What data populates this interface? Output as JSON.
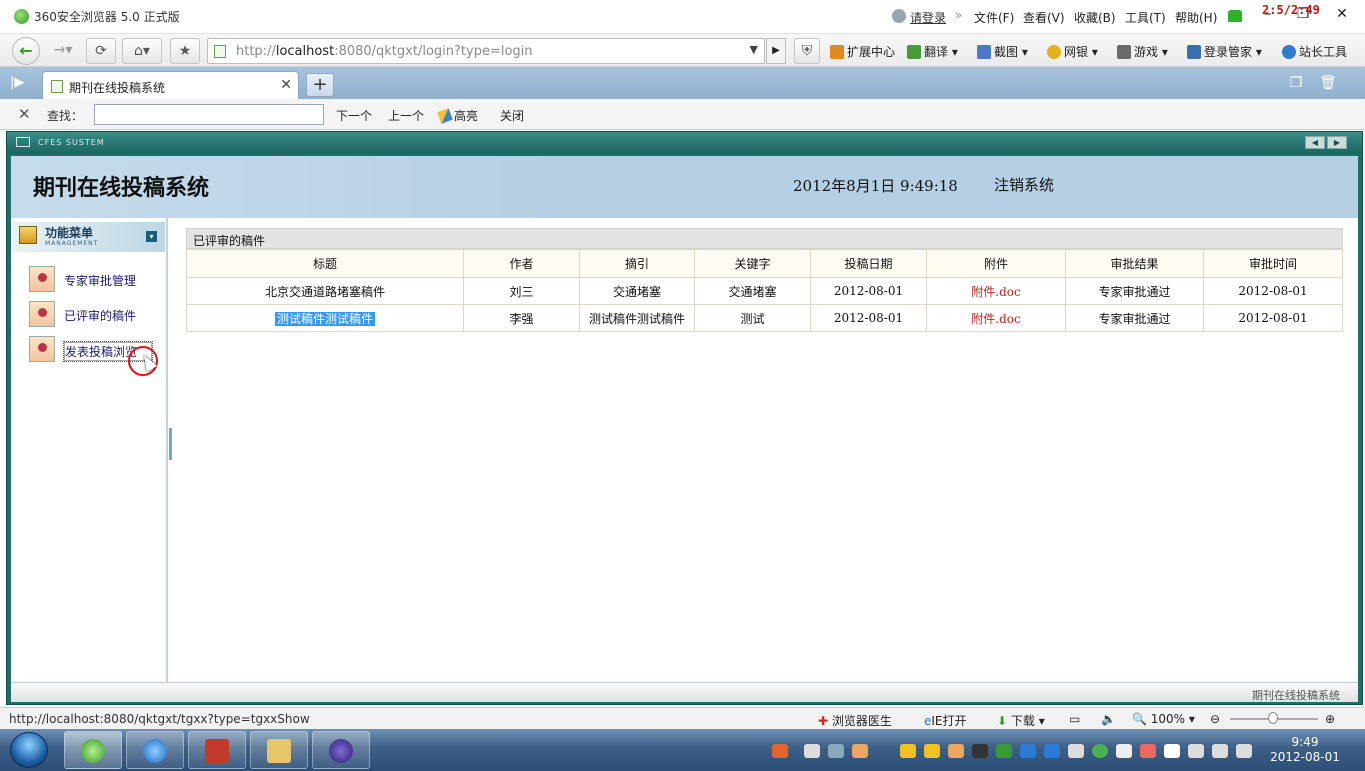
{
  "browser": {
    "title": "360安全浏览器 5.0 正式版",
    "login_link": "请登录",
    "menu": [
      "文件(F)",
      "查看(V)",
      "收藏(B)",
      "工具(T)",
      "帮助(H)"
    ],
    "recording_counter": "2:5/2:49",
    "url_prefix": "http://",
    "url_host": "localhost",
    "url_rest": ":8080/qktgxt/login?type=login",
    "tools": [
      "扩展中心",
      "翻译",
      "截图",
      "网银",
      "游戏",
      "登录管家",
      "站长工具"
    ],
    "tab_title": "期刊在线投稿系统",
    "find_label": "查找：",
    "find_value": "",
    "find_next": "下一个",
    "find_prev": "上一个",
    "find_highlight": "高亮",
    "find_close": "关闭"
  },
  "app": {
    "system_title": "期刊在线投稿系统",
    "strip_label": "CFES SUSTEM",
    "datetime": "2012年8月1日  9:49:18",
    "logout": "注销系统",
    "footer": "期刊在线投稿系统"
  },
  "sidebar": {
    "title": "功能菜单",
    "subtitle": "MANAGEMENT",
    "items": [
      {
        "label": "专家审批管理"
      },
      {
        "label": "已评审的稿件"
      },
      {
        "label": "发表投稿浏览"
      }
    ]
  },
  "table": {
    "caption": "已评审的稿件",
    "columns": [
      "标题",
      "作者",
      "摘引",
      "关键字",
      "投稿日期",
      "附件",
      "审批结果",
      "审批时间"
    ],
    "rows": [
      [
        "北京交通道路堵塞稿件",
        "刘三",
        "交通堵塞",
        "交通堵塞",
        "2012-08-01",
        "附件.doc",
        "专家审批通过",
        "2012-08-01"
      ],
      [
        "测试稿件测试稿件",
        "李强",
        "测试稿件测试稿件",
        "测试",
        "2012-08-01",
        "附件.doc",
        "专家审批通过",
        "2012-08-01"
      ]
    ]
  },
  "statusbar": {
    "url": "http://localhost:8080/qktgxt/tgxx?type=tgxxShow",
    "doctor": "浏览器医生",
    "ie_open": "IE打开",
    "download": "下载",
    "zoom": "100%"
  },
  "taskbar": {
    "time": "9:49",
    "date": "2012-08-01"
  },
  "colors": {
    "frame_teal": "#1f6e6a",
    "header_blue": "#b5d0e4",
    "attachment_red": "#c8211a",
    "selection_blue": "#3399ff"
  }
}
